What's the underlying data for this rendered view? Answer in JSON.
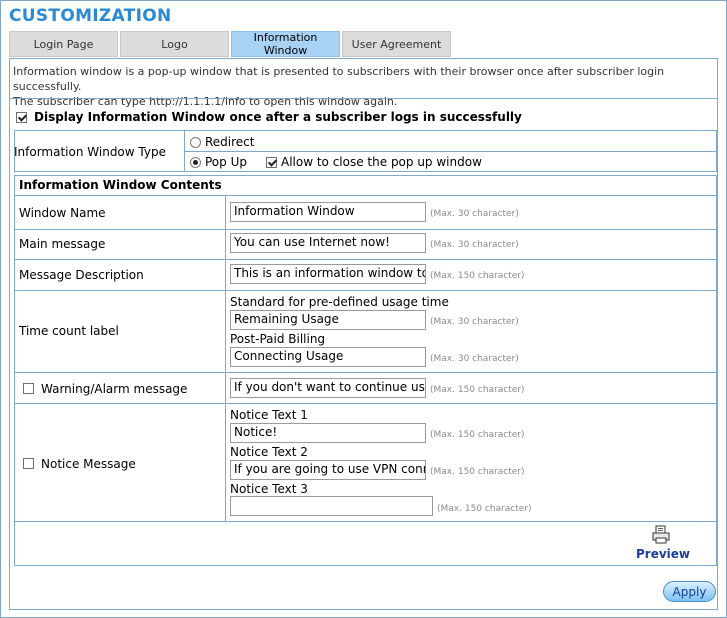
{
  "page": {
    "title": "CUSTOMIZATION",
    "tabs": [
      {
        "label": "Login Page"
      },
      {
        "label": "Logo"
      },
      {
        "label": "Information\nWindow"
      },
      {
        "label": "User Agreement"
      }
    ],
    "intro_line1": "Information window is a pop-up window that is presented to subscribers with their browser once after subscriber login successfully.",
    "intro_line2": "The subscriber can type http://1.1.1.1/info to open this window again."
  },
  "display_option": {
    "label": "Display Information Window once after a subscriber logs in successfully",
    "checked": true
  },
  "window_type": {
    "label": "Information Window Type",
    "redirect_label": "Redirect",
    "popup_label": "Pop Up",
    "allow_close_label": "Allow to close the pop up window"
  },
  "contents": {
    "section_title": "Information Window Contents",
    "window_name": {
      "label": "Window Name",
      "value": "Information Window",
      "hint": "(Max. 30 character)"
    },
    "main_message": {
      "label": "Main message",
      "value": "You can use Internet now!",
      "hint": "(Max. 30 character)"
    },
    "message_description": {
      "label": "Message Description",
      "value": "This is an information window to show",
      "hint": "(Max. 150 character)"
    },
    "time_count": {
      "label": "Time count label",
      "standard_label": "Standard for pre-defined usage time",
      "standard_value": "Remaining Usage",
      "standard_hint": "(Max. 30 character)",
      "postpaid_label": "Post-Paid Billing",
      "postpaid_value": "Connecting Usage",
      "postpaid_hint": "(Max. 30 character)"
    },
    "warning": {
      "label": "Warning/Alarm message",
      "value": "If you don't want to continue using Internet",
      "hint": "(Max. 150 character)"
    },
    "notice": {
      "label": "Notice Message",
      "text1_label": "Notice Text 1",
      "text1_value": "Notice!",
      "text1_hint": "(Max. 150 character)",
      "text2_label": "Notice Text 2",
      "text2_value": "If you are going to use VPN connection",
      "text2_hint": "(Max. 150 character)",
      "text3_label": "Notice Text 3",
      "text3_value": "",
      "text3_hint": "(Max. 150 character)"
    }
  },
  "actions": {
    "preview_label": "Preview",
    "apply_label": "Apply"
  }
}
